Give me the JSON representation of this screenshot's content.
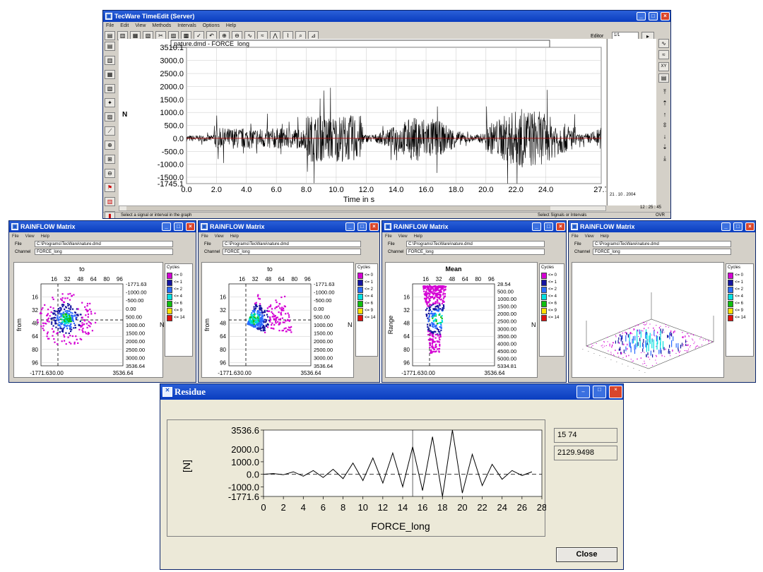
{
  "main": {
    "title": "TecWare TimeEdit (Server)",
    "menu": [
      "File",
      "Edit",
      "View",
      "Methods",
      "Intervals",
      "Options",
      "Help"
    ],
    "editor_label": "Editor",
    "editor_value": "1/1",
    "chart_title": "nature.dmd - FORCE_long",
    "ylabel": "N",
    "xlabel": "Time in s",
    "yticks": [
      "3510.1",
      "3000.0",
      "2500.0",
      "2000.0",
      "1500.0",
      "1000.0",
      "500.0",
      "0.0",
      "-500.0",
      "-1000.0",
      "-1500.0",
      "-1745.1"
    ],
    "xticks": [
      "0.0",
      "2.0",
      "4.0",
      "6.0",
      "8.0",
      "10.0",
      "12.0",
      "14.0",
      "16.0",
      "18.0",
      "20.0",
      "22.0",
      "24.0",
      "27.7"
    ],
    "status_left": "Select a signal or interval in the graph",
    "status_right": "Select Signals or Intervals",
    "status_ovr": "OVR",
    "side_info": "21 . 10 . 2004",
    "side_time": "12 : 25 : 45"
  },
  "rain1": {
    "title": "RAINFLOW Matrix",
    "file_label": "File",
    "file_value": "C:\\Programs\\TecWare\\nature.dmd",
    "channel_label": "Channel",
    "channel_value": "FORCE_long",
    "top_label": "to",
    "left_label": "from",
    "bottom_label": "N",
    "ticks": [
      "16",
      "32",
      "48",
      "64",
      "80",
      "96"
    ],
    "right_ticks": [
      "-1771.63",
      "-1000.00",
      "-500.00",
      "0.00",
      "500.00",
      "1000.00",
      "1500.00",
      "2000.00",
      "2500.00",
      "3000.00",
      "3536.64"
    ],
    "bottom_ticks": [
      "-1771.63",
      "0.00",
      "3536.64"
    ]
  },
  "rain2": {
    "title": "RAINFLOW Matrix",
    "file_label": "File",
    "file_value": "C:\\Programs\\TecWare\\nature.dmd",
    "channel_label": "Channel",
    "channel_value": "FORCE_long",
    "top_label": "to",
    "left_label": "from",
    "bottom_label": "N",
    "ticks": [
      "16",
      "32",
      "48",
      "64",
      "80",
      "96"
    ],
    "right_ticks": [
      "-1771.63",
      "-1000.00",
      "-500.00",
      "0.00",
      "500.00",
      "1000.00",
      "1500.00",
      "2000.00",
      "2500.00",
      "3000.00",
      "3536.64"
    ],
    "bottom_ticks": [
      "-1771.63",
      "0.00",
      "3536.64"
    ]
  },
  "rain3": {
    "title": "RAINFLOW Matrix",
    "file_label": "File",
    "file_value": "C:\\Programs\\TecWare\\nature.dmd",
    "channel_label": "Channel",
    "channel_value": "FORCE_long",
    "top_label": "Mean",
    "left_label": "Range",
    "bottom_label": "N",
    "ticks": [
      "16",
      "32",
      "48",
      "64",
      "80",
      "96"
    ],
    "right_ticks": [
      "28.54",
      "500.00",
      "1000.00",
      "1500.00",
      "2000.00",
      "2500.00",
      "3000.00",
      "3500.00",
      "4000.00",
      "4500.00",
      "5000.00",
      "5334.81"
    ],
    "bottom_ticks": [
      "-1771.63",
      "0.00",
      "3536.64"
    ]
  },
  "rain4": {
    "title": "RAINFLOW Matrix",
    "file_label": "File",
    "file_value": "C:\\Programs\\TecWare\\nature.dmd",
    "channel_label": "Channel",
    "channel_value": "FORCE_long"
  },
  "legend": {
    "title": "Cycles",
    "items": [
      "<= 0",
      "<= 1",
      "<= 2",
      "<= 4",
      "<= 6",
      "<= 9",
      "<= 14"
    ],
    "colors": [
      "#ffffff",
      "#d400d4",
      "#1414a0",
      "#2a6cff",
      "#00e0e0",
      "#10c010",
      "#ffe000",
      "#e01010"
    ]
  },
  "residue": {
    "title": "Residue",
    "ylabel": "[N]",
    "xlabel": "FORCE_long",
    "yticks": [
      "3536.6",
      "2000.0",
      "1000.0",
      "0.0",
      "-1000.0",
      "-1771.6"
    ],
    "xticks": [
      "0",
      "2",
      "4",
      "6",
      "8",
      "10",
      "12",
      "14",
      "16",
      "18",
      "20",
      "22",
      "24",
      "26",
      "28"
    ],
    "info1": "15 74",
    "info2": "2129.9498",
    "close_label": "Close"
  },
  "chart_data": [
    {
      "type": "line",
      "title": "nature.dmd - FORCE_long",
      "xlabel": "Time in s",
      "ylabel": "N",
      "xlim": [
        0,
        27.7
      ],
      "ylim": [
        -1745.1,
        3510.1
      ]
    },
    {
      "type": "line",
      "title": "Residue",
      "xlabel": "FORCE_long",
      "ylabel": "[N]",
      "xlim": [
        0,
        28
      ],
      "ylim": [
        -1771.6,
        3536.6
      ],
      "x": [
        0,
        1,
        2,
        3,
        4,
        5,
        6,
        7,
        8,
        9,
        10,
        11,
        12,
        13,
        14,
        15,
        16,
        17,
        18,
        19,
        20,
        21,
        22,
        23,
        24,
        25,
        26,
        27
      ],
      "y": [
        0,
        60,
        -40,
        200,
        -150,
        300,
        -250,
        400,
        -350,
        900,
        -500,
        1300,
        -700,
        1700,
        -1000,
        2200,
        -1300,
        3000,
        -1771,
        3536,
        -1500,
        1600,
        -900,
        800,
        -400,
        300,
        -100,
        200
      ]
    }
  ]
}
